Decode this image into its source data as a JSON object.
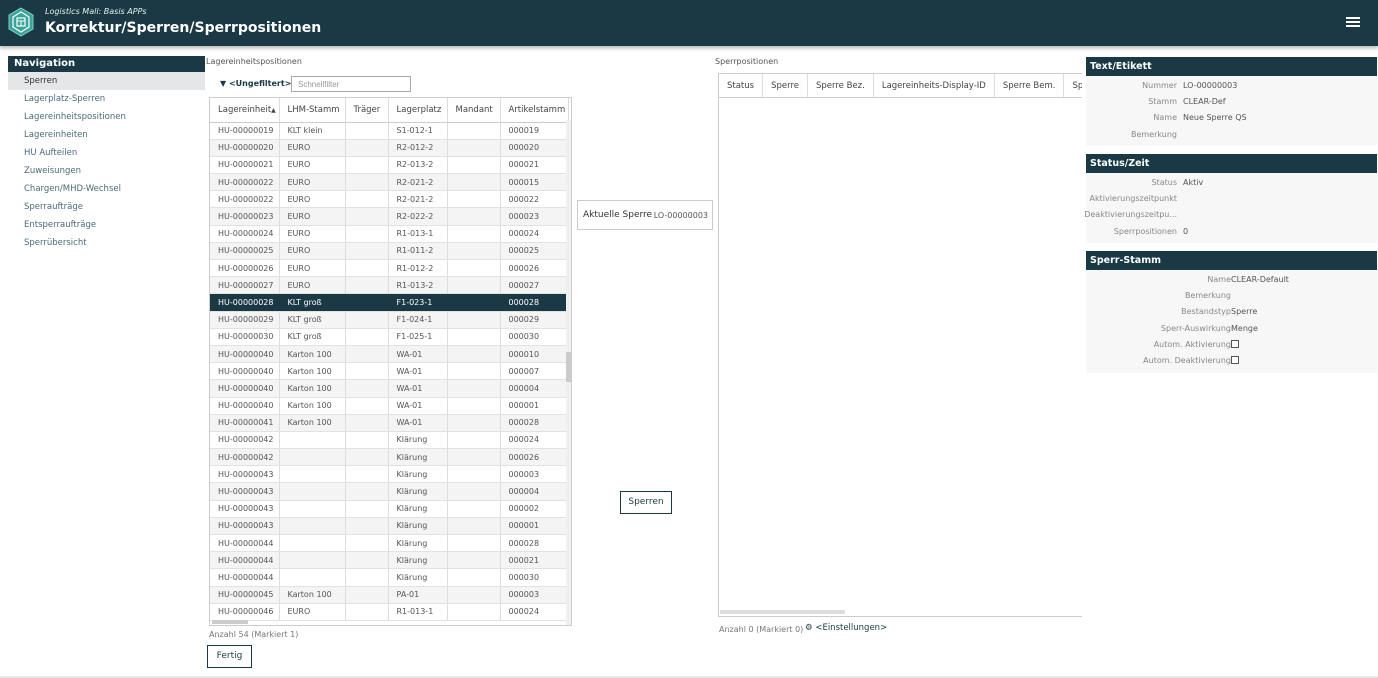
{
  "header": {
    "subtitle": "Logistics Mall: Basis APPs",
    "title": "Korrektur/Sperren/Sperrpositionen"
  },
  "nav": {
    "title": "Navigation",
    "items": [
      "Sperren",
      "Lagerplatz-Sperren",
      "Lagereinheitspositionen",
      "Lagereinheiten",
      "HU Aufteilen",
      "Zuweisungen",
      "Chargen/MHD-Wechsel",
      "Sperraufträge",
      "Entsperraufträge",
      "Sperrübersicht"
    ]
  },
  "left": {
    "label": "Lagereinheitspositionen",
    "filter_label": "<Ungefiltert>",
    "filter_placeholder": "Schnellfilter",
    "columns": [
      "Lagereinheit",
      "LHM-Stamm",
      "Träger",
      "Lagerplatz",
      "Mandant",
      "Artikelstamm"
    ],
    "rows": [
      [
        "HU-00000019",
        "KLT klein",
        "",
        "S1-012-1",
        "",
        "000019"
      ],
      [
        "HU-00000020",
        "EURO",
        "",
        "R2-012-2",
        "",
        "000020"
      ],
      [
        "HU-00000021",
        "EURO",
        "",
        "R2-013-2",
        "",
        "000021"
      ],
      [
        "HU-00000022",
        "EURO",
        "",
        "R2-021-2",
        "",
        "000015"
      ],
      [
        "HU-00000022",
        "EURO",
        "",
        "R2-021-2",
        "",
        "000022"
      ],
      [
        "HU-00000023",
        "EURO",
        "",
        "R2-022-2",
        "",
        "000023"
      ],
      [
        "HU-00000024",
        "EURO",
        "",
        "R1-013-1",
        "",
        "000024"
      ],
      [
        "HU-00000025",
        "EURO",
        "",
        "R1-011-2",
        "",
        "000025"
      ],
      [
        "HU-00000026",
        "EURO",
        "",
        "R1-012-2",
        "",
        "000026"
      ],
      [
        "HU-00000027",
        "EURO",
        "",
        "R1-013-2",
        "",
        "000027"
      ],
      [
        "HU-00000028",
        "KLT groß",
        "",
        "F1-023-1",
        "",
        "000028"
      ],
      [
        "HU-00000029",
        "KLT groß",
        "",
        "F1-024-1",
        "",
        "000029"
      ],
      [
        "HU-00000030",
        "KLT groß",
        "",
        "F1-025-1",
        "",
        "000030"
      ],
      [
        "HU-00000040",
        "Karton 100",
        "",
        "WA-01",
        "",
        "000010"
      ],
      [
        "HU-00000040",
        "Karton 100",
        "",
        "WA-01",
        "",
        "000007"
      ],
      [
        "HU-00000040",
        "Karton 100",
        "",
        "WA-01",
        "",
        "000004"
      ],
      [
        "HU-00000040",
        "Karton 100",
        "",
        "WA-01",
        "",
        "000001"
      ],
      [
        "HU-00000041",
        "Karton 100",
        "",
        "WA-01",
        "",
        "000028"
      ],
      [
        "HU-00000042",
        "",
        "",
        "Klärung",
        "",
        "000024"
      ],
      [
        "HU-00000042",
        "",
        "",
        "Klärung",
        "",
        "000026"
      ],
      [
        "HU-00000043",
        "",
        "",
        "Klärung",
        "",
        "000003"
      ],
      [
        "HU-00000043",
        "",
        "",
        "Klärung",
        "",
        "000004"
      ],
      [
        "HU-00000043",
        "",
        "",
        "Klärung",
        "",
        "000002"
      ],
      [
        "HU-00000043",
        "",
        "",
        "Klärung",
        "",
        "000001"
      ],
      [
        "HU-00000044",
        "",
        "",
        "Klärung",
        "",
        "000028"
      ],
      [
        "HU-00000044",
        "",
        "",
        "Klärung",
        "",
        "000021"
      ],
      [
        "HU-00000044",
        "",
        "",
        "Klärung",
        "",
        "000030"
      ],
      [
        "HU-00000045",
        "Karton 100",
        "",
        "PA-01",
        "",
        "000003"
      ],
      [
        "HU-00000046",
        "EURO",
        "",
        "R1-013-1",
        "",
        "000024"
      ]
    ],
    "selected_row": 10,
    "count": "Anzahl 54 (Markiert 1)",
    "done_label": "Fertig"
  },
  "middle": {
    "current_label": "Aktuelle Sperre",
    "current_value": "LO-00000003",
    "lock_button": "Sperren"
  },
  "right": {
    "label": "Sperrpositionen",
    "columns": [
      "Status",
      "Sperre",
      "Sperre Bez.",
      "Lagereinheits-Display-ID",
      "Sperre Bem.",
      "Sperre-St"
    ],
    "count": "Anzahl 0 (Markiert 0)",
    "settings_label": "<Einstellungen>"
  },
  "details": {
    "text_title": "Text/Etikett",
    "text_rows": [
      {
        "k": "Nummer",
        "v": "LO-00000003"
      },
      {
        "k": "Stamm",
        "v": "CLEAR-Def"
      },
      {
        "k": "Name",
        "v": "Neue Sperre QS"
      },
      {
        "k": "Bemerkung",
        "v": ""
      }
    ],
    "status_title": "Status/Zeit",
    "status_rows": [
      {
        "k": "Status",
        "v": "Aktiv"
      },
      {
        "k": "Aktivierungszeitpunkt",
        "v": ""
      },
      {
        "k": "Deaktivierungszeitpu...",
        "v": ""
      },
      {
        "k": "Sperrpositionen",
        "v": "0"
      }
    ],
    "master_title": "Sperr-Stamm",
    "master_rows": [
      {
        "k": "Name",
        "v": "CLEAR-Default"
      },
      {
        "k": "Bemerkung",
        "v": ""
      },
      {
        "k": "Bestandstyp",
        "v": "Sperre"
      },
      {
        "k": "Sperr-Auswirkung",
        "v": "Menge"
      }
    ],
    "auto_activation": "Autom. Aktivierung",
    "auto_deactivation": "Autom. Deaktivierung"
  }
}
